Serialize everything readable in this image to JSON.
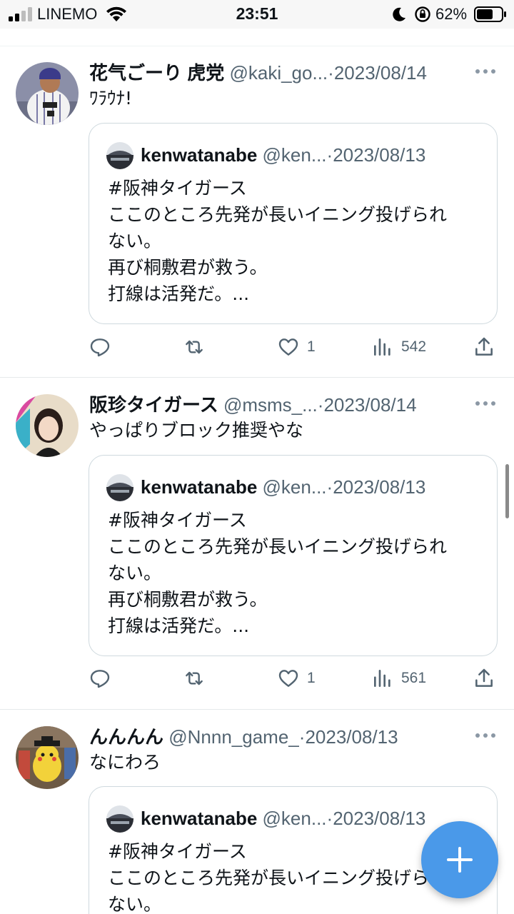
{
  "status_bar": {
    "carrier": "LINEMO",
    "time": "23:51",
    "battery": "62%"
  },
  "tweets": [
    {
      "name": "花气ごーり 虎党",
      "handle": "@kaki_go...",
      "sep": "·",
      "date": "2023/08/14",
      "text": "ﾜﾗｳﾅ!",
      "quote": {
        "name": "kenwatanabe",
        "handle": "@ken...",
        "sep": "·",
        "date": "2023/08/13",
        "lines": [
          "#阪神タイガース",
          "ここのところ先発が長いイニング投げられ",
          "ない。",
          "再び桐敷君が救う。",
          "打線は活発だ。..."
        ]
      },
      "actions": {
        "reply": "",
        "retweet": "",
        "like": "1",
        "views": "542"
      }
    },
    {
      "name": "阪珍タイガース",
      "handle": "@msms_...",
      "sep": "·",
      "date": "2023/08/14",
      "text": "やっぱりブロック推奨やな",
      "quote": {
        "name": "kenwatanabe",
        "handle": "@ken...",
        "sep": "·",
        "date": "2023/08/13",
        "lines": [
          "#阪神タイガース",
          "ここのところ先発が長いイニング投げられ",
          "ない。",
          "再び桐敷君が救う。",
          "打線は活発だ。..."
        ]
      },
      "actions": {
        "reply": "",
        "retweet": "",
        "like": "1",
        "views": "561"
      }
    },
    {
      "name": "んんんん",
      "handle": "@Nnnn_game_",
      "sep": "·",
      "date": "2023/08/13",
      "text": "なにわろ",
      "quote": {
        "name": "kenwatanabe",
        "handle": "@ken...",
        "sep": "·",
        "date": "2023/08/13",
        "lines": [
          "#阪神タイガース",
          "ここのところ先発が長いイニング投げられ",
          "ない。"
        ]
      }
    }
  ],
  "fab": {
    "icon": "plus-icon",
    "color": "#4a99e9"
  },
  "colors": {
    "accent": "#1d9bf0",
    "secondary_text": "#536471",
    "border": "#cfd9de"
  }
}
